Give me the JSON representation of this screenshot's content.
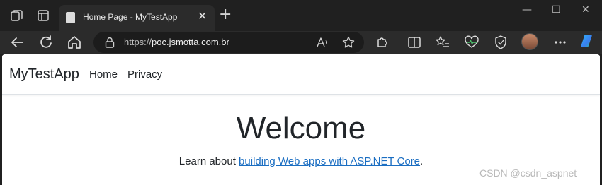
{
  "tab": {
    "title": "Home Page - MyTestApp",
    "close": "✕",
    "new_tab": "+"
  },
  "window": {
    "minimize": "—",
    "maximize": "☐",
    "close": "✕"
  },
  "address": {
    "scheme": "https://",
    "host": "poc.jsmotta.com.br"
  },
  "site": {
    "brand": "MyTestApp",
    "nav": [
      {
        "label": "Home"
      },
      {
        "label": "Privacy"
      }
    ],
    "heading": "Welcome",
    "learn_prefix": "Learn about ",
    "learn_link": "building Web apps with ASP.NET Core",
    "learn_suffix": "."
  },
  "watermark": "CSDN @csdn_aspnet",
  "colors": {
    "accent_link": "#1b6ec2",
    "chrome_dark": "#202020",
    "chrome_toolbar": "#2b2b2b"
  }
}
